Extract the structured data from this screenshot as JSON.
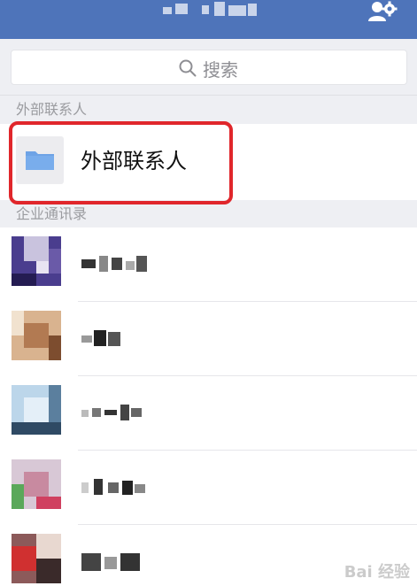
{
  "header": {
    "title": "",
    "user_settings_icon": "user-settings-icon",
    "bar_color": "#4e74ba"
  },
  "search": {
    "label": "搜索",
    "icon": "search-icon"
  },
  "sections": {
    "external_header": "外部联系人",
    "directory_header": "企业通讯录"
  },
  "external_contacts": {
    "label": "外部联系人",
    "icon": "folder-icon",
    "highlight_color": "#e0262b"
  },
  "contacts": [
    {
      "name": "",
      "avatar": "avatar-pixelated"
    },
    {
      "name": "",
      "avatar": "avatar-pixelated"
    },
    {
      "name": "",
      "avatar": "avatar-pixelated"
    },
    {
      "name": "",
      "avatar": "avatar-pixelated"
    },
    {
      "name": "",
      "avatar": "avatar-pixelated"
    }
  ],
  "watermark": {
    "text": "Bai 经验"
  }
}
